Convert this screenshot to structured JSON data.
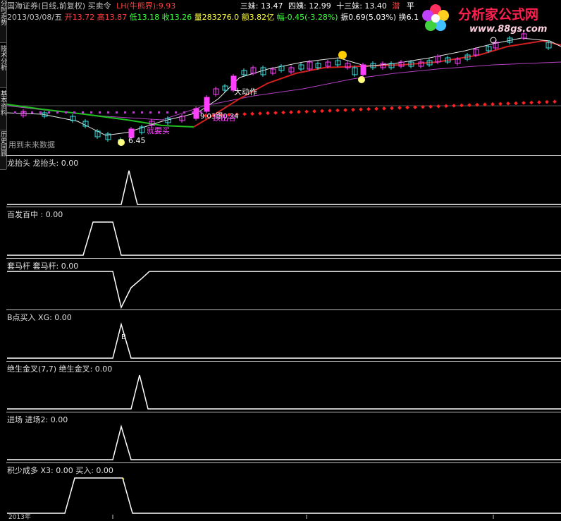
{
  "header": {
    "line1": {
      "broker": "国海证券(日线,前复权)",
      "indicator_name": "买卖令",
      "lh_label": "LH(牛熊界):",
      "lh_value": "9.93",
      "s3": "三妹: 13.47",
      "s4": "四姨: 12.99",
      "s13": "十三妹: 13.40",
      "tail1": "潜",
      "tail2": "平"
    },
    "line2": {
      "date": "2013/03/08/五",
      "open": "开13.72",
      "high": "高13.87",
      "low": "低13.18",
      "close": "收13.26",
      "vol": "量283276.0",
      "amount": "额3.82亿",
      "change": "幅-0.45(-3.28%)",
      "amplitude": "振0.69(5.03%)",
      "turnover": "换6.1"
    }
  },
  "left_tabs": [
    "分时走势",
    "技术分析",
    "基本资料",
    "历史回顾"
  ],
  "annotations": {
    "big_action": "大动作",
    "price_level": "9.03跟0.34",
    "buy_signal": "跃出谷",
    "go_buy": "就要买",
    "low_price": "6.45",
    "future_data": "用到未来数据",
    "b_marker": "B",
    "dollar": "$"
  },
  "panels": [
    {
      "title": "龙抬头  龙抬头: 0.00"
    },
    {
      "title": "百发百中 : 0.00"
    },
    {
      "title": "套马杆  套马杆: 0.00"
    },
    {
      "title": "B点买入   XG: 0.00"
    },
    {
      "title": "绝生金叉(7,7)  绝生金叉: 0.00"
    },
    {
      "title": "进场  进场2: 0.00"
    },
    {
      "title": "积少成多  X3: 0.00  买入: 0.00"
    }
  ],
  "bottom_axis": {
    "year_label": "2013年"
  },
  "logo": {
    "text": "分析家公式网",
    "url": "www.88gs.com"
  },
  "colors": {
    "red_line": "#d02020",
    "green_line": "#20c020",
    "magenta_line": "#b040c0",
    "white_line": "#e8e8e8",
    "candle_up": "#ff40ff",
    "candle_down": "#40e0e0",
    "dots": "#ff2020",
    "logo": "#ff2050"
  }
}
